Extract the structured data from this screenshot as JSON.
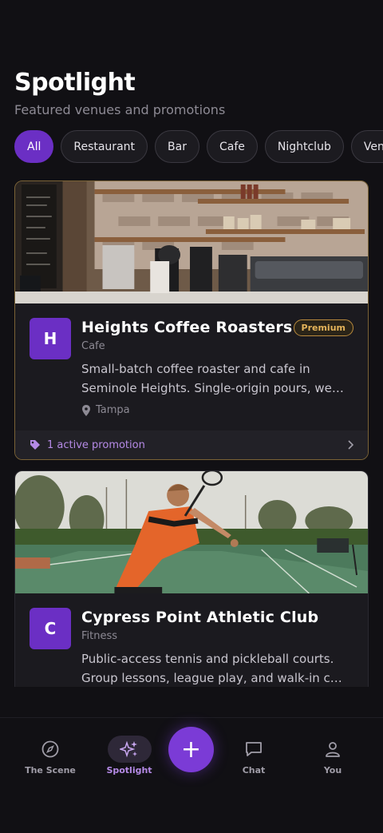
{
  "header": {
    "title": "Spotlight",
    "subtitle": "Featured venues and promotions"
  },
  "filters": [
    {
      "label": "All",
      "active": true
    },
    {
      "label": "Restaurant",
      "active": false
    },
    {
      "label": "Bar",
      "active": false
    },
    {
      "label": "Cafe",
      "active": false
    },
    {
      "label": "Nightclub",
      "active": false
    },
    {
      "label": "Venue",
      "active": false
    }
  ],
  "venues": [
    {
      "initial": "H",
      "name": "Heights Coffee Roasters",
      "category": "Cafe",
      "badge": "Premium",
      "description": "Small-batch coffee roaster and cafe in Seminole Heights. Single-origin pours, we…",
      "location": "Tampa",
      "promotion": "1 active promotion"
    },
    {
      "initial": "C",
      "name": "Cypress Point Athletic Club",
      "category": "Fitness",
      "description": "Public-access tennis and pickleball courts. Group lessons, league play, and walk-in c…"
    }
  ],
  "nav": {
    "scene": "The Scene",
    "spotlight": "Spotlight",
    "add": "+",
    "chat": "Chat",
    "you": "You"
  },
  "colors": {
    "background": "#111014",
    "accent": "#6b2fc4",
    "premium": "#e3b35a",
    "promo_text": "#b58ae6"
  }
}
